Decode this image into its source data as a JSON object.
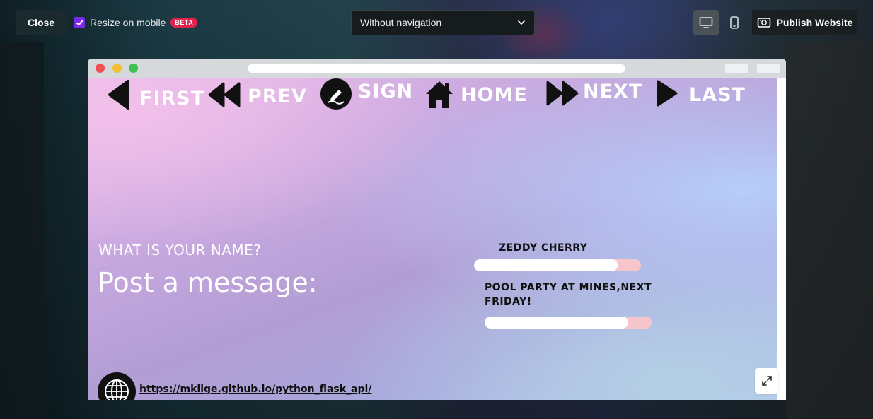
{
  "toolbar": {
    "close_label": "Close",
    "resize_label": "Resize on mobile",
    "resize_checked": true,
    "beta_badge": "BETA",
    "navigation_select": "Without navigation",
    "publish_label": "Publish Website",
    "view_mode": "desktop"
  },
  "site": {
    "nav": [
      {
        "label": "FIRST",
        "icon": "caret-left-icon"
      },
      {
        "label": "PREV",
        "icon": "rewind-icon"
      },
      {
        "label": "SIGN",
        "icon": "pen-icon"
      },
      {
        "label": "HOME",
        "icon": "home-icon"
      },
      {
        "label": "NEXT",
        "icon": "fast-forward-icon"
      },
      {
        "label": "LAST",
        "icon": "caret-right-icon"
      }
    ],
    "question": "WHAT IS YOUR NAME?",
    "post_prompt": "Post a message:",
    "entry_name": "ZEDDY CHERRY",
    "entry_message": "POOL PARTY AT MINES,NEXT FRIDAY!",
    "link_url": "https://mkiige.github.io/python_flask_api/"
  },
  "colors": {
    "accent_purple": "#7d2ae8",
    "beta_red": "#e0234e",
    "bar_pink": "#f7c6cc"
  }
}
